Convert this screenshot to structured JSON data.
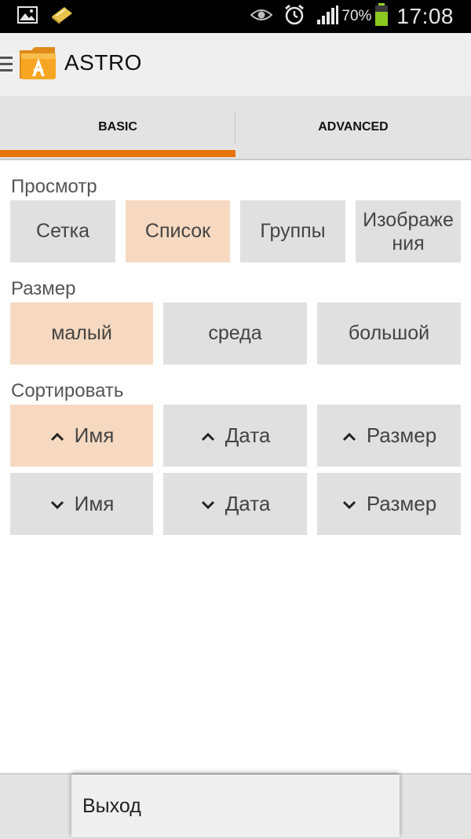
{
  "status_bar": {
    "battery_percent": "70%",
    "time": "17:08",
    "icons": [
      "gallery-icon",
      "notification-icon",
      "eye-icon",
      "alarm-icon",
      "signal-icon",
      "battery-icon"
    ]
  },
  "app": {
    "title": "ASTRO",
    "icon": "astro-folder-icon"
  },
  "tabs": [
    {
      "label": "BASIC",
      "selected": true
    },
    {
      "label": "ADVANCED",
      "selected": false
    }
  ],
  "view": {
    "label": "Просмотр",
    "options": [
      {
        "label": "Сетка",
        "selected": false
      },
      {
        "label": "Список",
        "selected": true
      },
      {
        "label": "Группы",
        "selected": false
      },
      {
        "label": "Изображения",
        "line1": "Изображе",
        "line2": "ния",
        "selected": false
      }
    ]
  },
  "size": {
    "label": "Размер",
    "options": [
      {
        "label": "малый",
        "selected": true
      },
      {
        "label": "среда",
        "selected": false
      },
      {
        "label": "большой",
        "selected": false
      }
    ]
  },
  "sort": {
    "label": "Сортировать",
    "options": [
      {
        "label": "Имя",
        "direction": "ascending",
        "selected": true
      },
      {
        "label": "Дата",
        "direction": "ascending",
        "selected": false
      },
      {
        "label": "Размер",
        "direction": "ascending",
        "selected": false
      },
      {
        "label": "Имя",
        "direction": "descending",
        "selected": false
      },
      {
        "label": "Дата",
        "direction": "descending",
        "selected": false
      },
      {
        "label": "Размер",
        "direction": "descending",
        "selected": false
      }
    ]
  },
  "menu": {
    "exit_label": "Выход"
  },
  "colors": {
    "accent": "#e8730b",
    "selected_bg": "#f6d9c0",
    "button_bg": "#e0e0e0"
  }
}
